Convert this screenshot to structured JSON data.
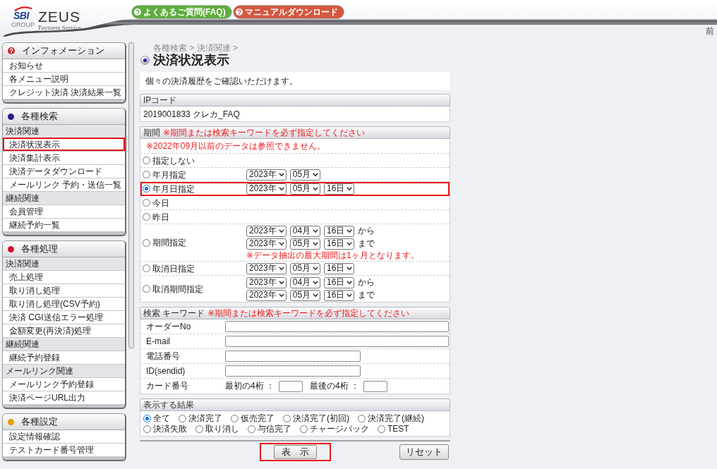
{
  "header": {
    "logo": {
      "mark": "SBI",
      "group": "GROUP",
      "name": "ZEUS",
      "tagline": "Payment Service"
    },
    "links": [
      {
        "label": "よくあるご質問(FAQ)",
        "color": "#5fae3f"
      },
      {
        "label": "マニュアルダウンロード",
        "color": "#d5573f"
      }
    ],
    "corner_text": "前"
  },
  "sidebar": {
    "groups": [
      {
        "title": "インフォメーション",
        "kind": "question",
        "color": "#c8262c",
        "sections": [
          {
            "items": [
              {
                "label": "お知らせ",
                "highlighted": false
              },
              {
                "label": "各メニュー説明",
                "highlighted": false
              },
              {
                "label": "クレジット決済 決済結果一覧",
                "highlighted": false
              }
            ]
          }
        ]
      },
      {
        "title": "各種検索",
        "kind": "dot",
        "color": "#2d1a8e",
        "sections": [
          {
            "heading": "決済関連",
            "items": [
              {
                "label": "決済状況表示",
                "highlighted": true
              },
              {
                "label": "決済集計表示",
                "highlighted": false
              },
              {
                "label": "決済データダウンロード",
                "highlighted": false
              },
              {
                "label": "メールリンク 予約・送信一覧",
                "highlighted": false
              }
            ]
          },
          {
            "heading": "継続関連",
            "items": [
              {
                "label": "会員管理",
                "highlighted": false
              },
              {
                "label": "継続予約一覧",
                "highlighted": false
              }
            ]
          }
        ]
      },
      {
        "title": "各種処理",
        "kind": "dot",
        "color": "#d5102b",
        "sections": [
          {
            "heading": "決済関連",
            "items": [
              {
                "label": "売上処理",
                "highlighted": false
              },
              {
                "label": "取り消し処理",
                "highlighted": false
              },
              {
                "label": "取り消し処理(CSV予約)",
                "highlighted": false
              },
              {
                "label": "決済 CGI送信エラー処理",
                "highlighted": false
              },
              {
                "label": "金額変更(再決済)処理",
                "highlighted": false
              }
            ]
          },
          {
            "heading": "継続関連",
            "items": [
              {
                "label": "継続予約登録",
                "highlighted": false
              }
            ]
          },
          {
            "heading": "メールリンク関連",
            "items": [
              {
                "label": "メールリンク予約登録",
                "highlighted": false
              },
              {
                "label": "決済ページURL出力",
                "highlighted": false
              }
            ]
          }
        ]
      },
      {
        "title": "各種設定",
        "kind": "dot",
        "color": "#e2a106",
        "sections": [
          {
            "items": [
              {
                "label": "設定情報確認",
                "highlighted": false
              },
              {
                "label": "テストカード番号管理",
                "highlighted": false
              }
            ]
          }
        ]
      }
    ]
  },
  "page": {
    "breadcrumb": "各種検索 > 決済関連 >",
    "title": "決済状況表示",
    "intro": "個々の決済履歴をご確認いただけます。"
  },
  "ip_code": {
    "title": "IPコード",
    "value": "2019001833 クレカ_FAQ"
  },
  "period": {
    "title": "期間",
    "note": "※期間または検索キーワードを必ず指定してください",
    "warning": "※2022年09月以前のデータは参照できません。",
    "options": [
      {
        "label": "指定しない",
        "selected": false,
        "highlighted": false
      },
      {
        "label": "年月指定",
        "selected": false,
        "highlighted": false,
        "date_rows": [
          {
            "dropdowns": [
              "2023年",
              "05月"
            ]
          }
        ]
      },
      {
        "label": "年月日指定",
        "selected": true,
        "highlighted": true,
        "date_rows": [
          {
            "dropdowns": [
              "2023年",
              "05月",
              "16日"
            ]
          }
        ]
      },
      {
        "label": "今日",
        "selected": false,
        "highlighted": false
      },
      {
        "label": "昨日",
        "selected": false,
        "highlighted": false
      },
      {
        "label": "期間指定",
        "selected": false,
        "highlighted": false,
        "date_rows": [
          {
            "dropdowns": [
              "2023年",
              "04月",
              "16日"
            ],
            "suffix": "から"
          },
          {
            "dropdowns": [
              "2023年",
              "05月",
              "16日"
            ],
            "suffix": "まで"
          }
        ],
        "note": "※データ抽出の最大期間は1ヶ月となります。"
      },
      {
        "label": "取消日指定",
        "selected": false,
        "highlighted": false,
        "date_rows": [
          {
            "dropdowns": [
              "2023年",
              "05月",
              "16日"
            ]
          }
        ]
      },
      {
        "label": "取消期間指定",
        "selected": false,
        "highlighted": false,
        "date_rows": [
          {
            "dropdowns": [
              "2023年",
              "04月",
              "16日"
            ],
            "suffix": "から"
          },
          {
            "dropdowns": [
              "2023年",
              "05月",
              "16日"
            ],
            "suffix": "まで"
          }
        ]
      }
    ]
  },
  "keyword": {
    "title": "検索 キーワード",
    "note": "※期間または検索キーワードを必ず指定してください",
    "fields": [
      {
        "label": "オーダーNo",
        "kind": "wide"
      },
      {
        "label": "E-mail",
        "kind": "wide"
      },
      {
        "label": "電話番号",
        "kind": "medium"
      },
      {
        "label": "ID(sendid)",
        "kind": "medium"
      },
      {
        "label": "カード番号",
        "kind": "card",
        "parts": [
          "最初の4桁 ：",
          "最後の4桁 ："
        ]
      }
    ]
  },
  "results": {
    "title": "表示する結果",
    "options": [
      {
        "label": "全て",
        "selected": true
      },
      {
        "label": "決済完了",
        "selected": false
      },
      {
        "label": "仮売完了",
        "selected": false
      },
      {
        "label": "決済完了(初回)",
        "selected": false
      },
      {
        "label": "決済完了(継続)",
        "selected": false
      },
      {
        "label": "決済失敗",
        "selected": false
      },
      {
        "label": "取り消し",
        "selected": false
      },
      {
        "label": "与信完了",
        "selected": false
      },
      {
        "label": "チャージバック",
        "selected": false
      },
      {
        "label": "TEST",
        "selected": false
      }
    ]
  },
  "buttons": [
    {
      "label": "表　示",
      "kind": "submit",
      "highlighted": true
    },
    {
      "label": "リセット",
      "kind": "reset",
      "highlighted": false
    }
  ]
}
